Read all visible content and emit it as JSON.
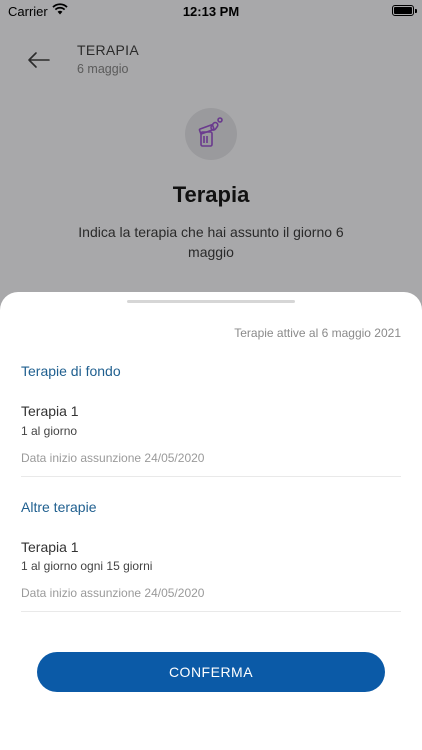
{
  "status": {
    "carrier": "Carrier",
    "time": "12:13 PM"
  },
  "header": {
    "title": "TERAPIA",
    "subtitle": "6 maggio"
  },
  "hero": {
    "title": "Terapia",
    "description": "Indica la terapia che hai assunto il giorno 6 maggio"
  },
  "sheet": {
    "active_note": "Terapie attive al 6 maggio 2021",
    "sections": [
      {
        "title": "Terapie di fondo",
        "items": [
          {
            "name": "Terapia 1",
            "dose": "1 al giorno",
            "start": "Data inizio assunzione 24/05/2020"
          }
        ]
      },
      {
        "title": "Altre terapie",
        "items": [
          {
            "name": "Terapia 1",
            "dose": "1 al giorno ogni 15 giorni",
            "start": "Data inizio assunzione 24/05/2020"
          }
        ]
      }
    ],
    "confirm_label": "CONFERMA"
  },
  "colors": {
    "accent": "#0b5aa7",
    "section_title": "#1f5f8f",
    "icon_purple": "#7b3fa8",
    "overlay": "#a8a8aa"
  },
  "icons": {
    "back": "arrow-left-icon",
    "hero": "medicine-pills-icon",
    "wifi": "wifi-icon",
    "battery": "battery-icon"
  }
}
